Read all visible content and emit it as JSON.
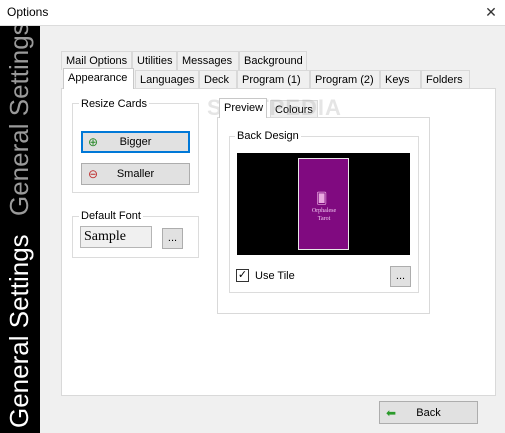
{
  "window": {
    "title": "Options",
    "close_glyph": "✕"
  },
  "banner": {
    "text": "General Settings"
  },
  "tabs_row1": [
    "Mail Options",
    "Utilities",
    "Messages",
    "Background"
  ],
  "tabs_row2": [
    "Appearance",
    "Languages",
    "Deck",
    "Program (1)",
    "Program (2)",
    "Keys",
    "Folders"
  ],
  "active_tab": "Appearance",
  "resize_cards": {
    "label": "Resize Cards",
    "bigger": "Bigger",
    "smaller": "Smaller"
  },
  "default_font": {
    "label": "Default Font",
    "sample": "Sample",
    "browse": "..."
  },
  "subtabs": [
    "Preview",
    "Colours"
  ],
  "back_design": {
    "label": "Back Design",
    "card_caption_1": "Orphalese",
    "card_caption_2": "Tarot",
    "use_tile_label": "Use Tile",
    "use_tile_checked": true,
    "browse": "..."
  },
  "watermark": "SOFTPEDIA",
  "footer": {
    "back": "Back"
  },
  "colors": {
    "card": "#800a80",
    "banner": "#000000",
    "accent": "#0078d7"
  }
}
